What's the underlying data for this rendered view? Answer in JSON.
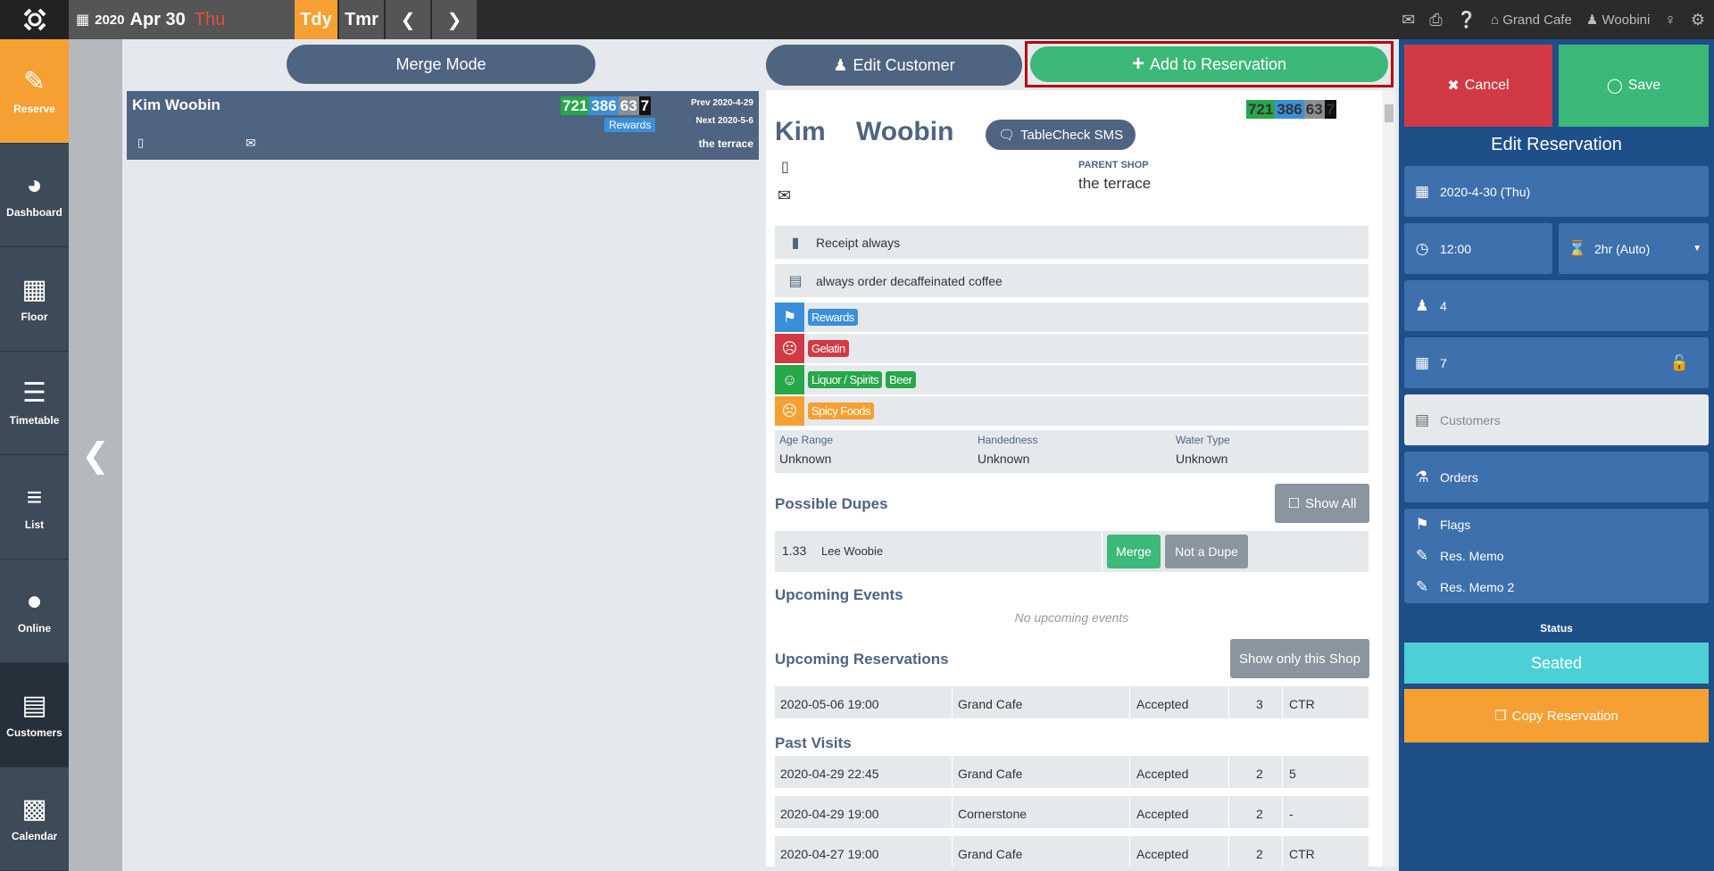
{
  "topbar": {
    "year": "2020",
    "month_day": "Apr 30",
    "weekday": "Thu",
    "today_label": "Tdy",
    "tomorrow_label": "Tmr",
    "shop_name": "Grand Cafe",
    "user_name": "Woobini"
  },
  "nav": [
    {
      "label": "Reserve",
      "icon": "reserve-icon"
    },
    {
      "label": "Dashboard",
      "icon": "dashboard-icon"
    },
    {
      "label": "Floor",
      "icon": "floor-icon"
    },
    {
      "label": "Timetable",
      "icon": "timetable-icon"
    },
    {
      "label": "List",
      "icon": "list-icon"
    },
    {
      "label": "Online",
      "icon": "globe-icon"
    },
    {
      "label": "Customers",
      "icon": "customers-icon"
    },
    {
      "label": "Calendar",
      "icon": "calendar-icon"
    }
  ],
  "left": {
    "merge_mode_label": "Merge Mode",
    "customer_card": {
      "name": "Kim Woobin",
      "scores": [
        "721",
        "386",
        "63",
        "7"
      ],
      "tag": "Rewards",
      "prev": "Prev 2020-4-29",
      "next": "Next 2020-5-6",
      "shop": "the terrace"
    }
  },
  "actions": {
    "edit_customer_label": "Edit Customer",
    "add_reservation_label": "Add to Reservation"
  },
  "customer": {
    "scores": [
      "721",
      "386",
      "63",
      "7"
    ],
    "first_name": "Kim",
    "last_name": "Woobin",
    "sms_label": "TableCheck SMS",
    "parent_shop_label": "PARENT SHOP",
    "parent_shop": "the terrace",
    "memos": [
      "Receipt always",
      "always order decaffeinated coffee"
    ],
    "tag_rows": [
      {
        "icon": "tag-icon",
        "color": "#3b8fd8",
        "tags": [
          {
            "text": "Rewards",
            "color": "#3b8fd8"
          }
        ]
      },
      {
        "icon": "dislike-icon",
        "color": "#d13a44",
        "tags": [
          {
            "text": "Gelatin",
            "color": "#d13a44"
          }
        ]
      },
      {
        "icon": "smile-icon",
        "color": "#27a74a",
        "tags": [
          {
            "text": "Liquor / Spirits",
            "color": "#27a74a"
          },
          {
            "text": "Beer",
            "color": "#27a74a"
          }
        ]
      },
      {
        "icon": "frown-icon",
        "color": "#f6a033",
        "tags": [
          {
            "text": "Spicy Foods",
            "color": "#f6a033"
          }
        ]
      }
    ],
    "attributes": [
      {
        "label": "Age Range",
        "value": "Unknown"
      },
      {
        "label": "Handedness",
        "value": "Unknown"
      },
      {
        "label": "Water Type",
        "value": "Unknown"
      }
    ],
    "dupes_title": "Possible Dupes",
    "show_all_label": "Show All",
    "dupes": [
      {
        "score": "1.33",
        "name": "Lee Woobie",
        "merge_label": "Merge",
        "not_dupe_label": "Not a Dupe"
      }
    ],
    "events_title": "Upcoming Events",
    "no_events": "No upcoming events",
    "upcoming_title": "Upcoming Reservations",
    "show_shop_label": "Show only this Shop",
    "upcoming": [
      {
        "date": "2020-05-06 19:00",
        "shop": "Grand Cafe",
        "status": "Accepted",
        "pax": "3",
        "table": "CTR"
      }
    ],
    "past_title": "Past Visits",
    "past": [
      {
        "date": "2020-04-29 22:45",
        "shop": "Grand Cafe",
        "status": "Accepted",
        "pax": "2",
        "table": "5"
      },
      {
        "date": "2020-04-29 19:00",
        "shop": "Cornerstone",
        "status": "Accepted",
        "pax": "2",
        "table": "-"
      },
      {
        "date": "2020-04-27 19:00",
        "shop": "Grand Cafe",
        "status": "Accepted",
        "pax": "2",
        "table": "CTR"
      }
    ]
  },
  "reservation": {
    "cancel_label": "Cancel",
    "save_label": "Save",
    "title": "Edit Reservation",
    "date": "2020-4-30 (Thu)",
    "time": "12:00",
    "duration": "2hr (Auto)",
    "pax": "4",
    "table": "7",
    "customers_placeholder": "Customers",
    "orders_label": "Orders",
    "flags_label": "Flags",
    "memo_label": "Res. Memo",
    "memo2_label": "Res. Memo 2",
    "status_label": "Status",
    "status_value": "Seated",
    "copy_label": "Copy Reservation"
  },
  "colors": {
    "accent": "#f6a033",
    "panel_blue": "#1e4f89",
    "slate": "#4f6480",
    "green": "#3cb878",
    "red": "#d13a44",
    "cyan": "#4ccfd6"
  }
}
